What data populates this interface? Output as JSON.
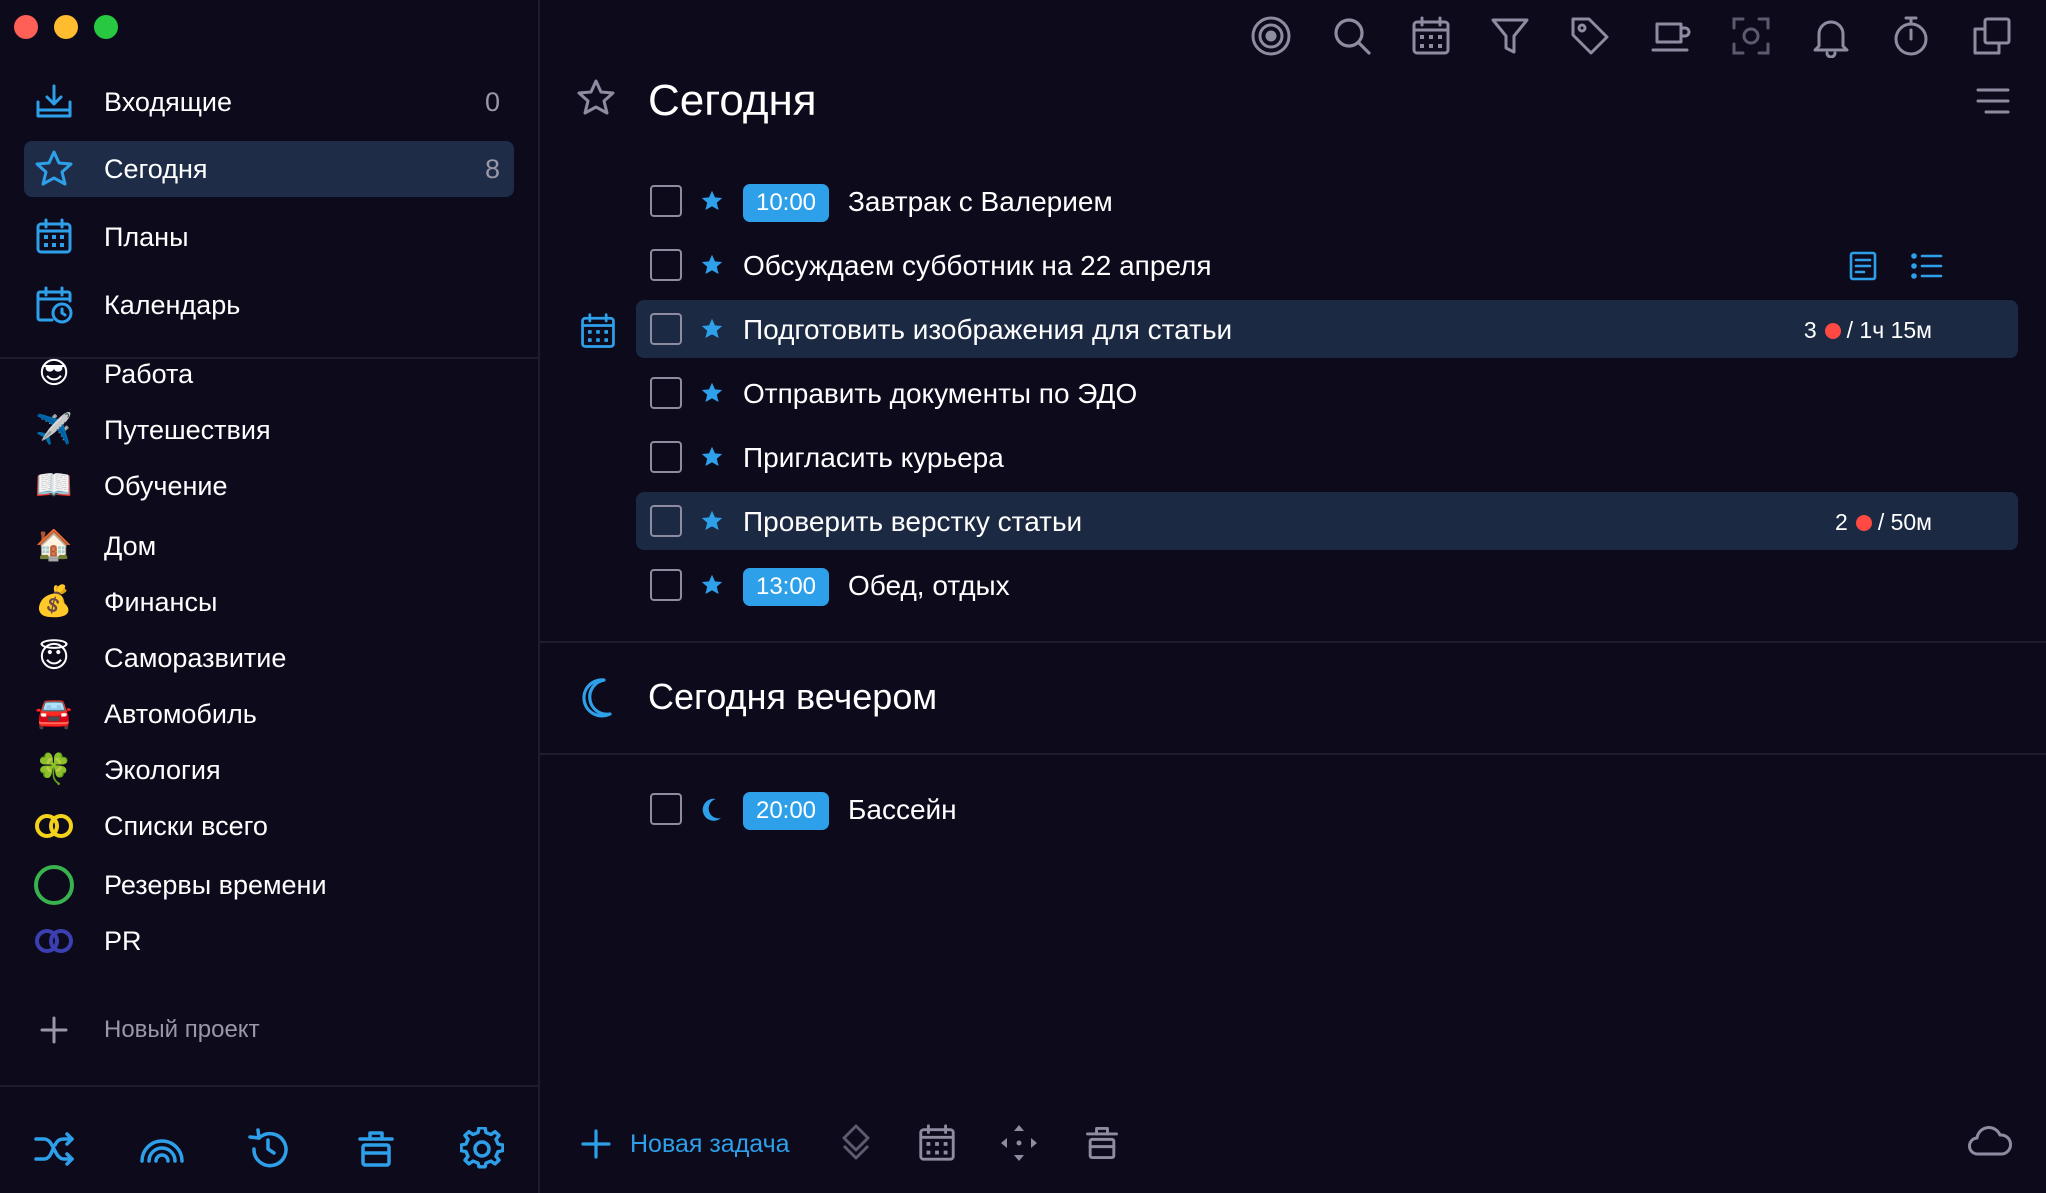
{
  "colors": {
    "background": "#0d0a1c",
    "active_row": "#1e2c48",
    "accent_blue": "#2ea0ea",
    "divider": "#1f1c30",
    "muted_text": "#9a98a8",
    "dot_red": "#ff4a43"
  },
  "window_controls": [
    "close",
    "minimize",
    "zoom"
  ],
  "sidebar": {
    "nav": [
      {
        "label": "Входящие",
        "count": "0",
        "icon": "inbox-icon"
      },
      {
        "label": "Сегодня",
        "count": "8",
        "icon": "star-icon",
        "active": true
      },
      {
        "label": "Планы",
        "count": "",
        "icon": "calendar-grid-icon"
      },
      {
        "label": "Календарь",
        "count": "",
        "icon": "calendar-clock-icon"
      }
    ],
    "projects": [
      {
        "label": "Работа",
        "icon": "😎"
      },
      {
        "label": "Путешествия",
        "icon": "✈️"
      },
      {
        "label": "Обучение",
        "icon": "📖"
      },
      {
        "label": "Дом",
        "icon": "🏠"
      },
      {
        "label": "Финансы",
        "icon": "💰"
      },
      {
        "label": "Саморазвитие",
        "icon": "😇"
      },
      {
        "label": "Автомобиль",
        "icon": "🚘"
      },
      {
        "label": "Экология",
        "icon": "🍀"
      },
      {
        "label": "Списки всего",
        "icon": "yellow-double-ring-icon"
      },
      {
        "label": "Резервы времени",
        "icon": "green-ring-icon"
      },
      {
        "label": "PR",
        "icon": "blue-double-ring-icon"
      }
    ],
    "new_project_label": "Новый проект",
    "bottom_icons": [
      "shuffle-icon",
      "rainbow-icon",
      "history-icon",
      "trash-icon",
      "settings-icon"
    ]
  },
  "toolbar": {
    "icons": [
      "focus-icon",
      "search-icon",
      "calendar-icon",
      "filter-icon",
      "tag-icon",
      "coffee-icon",
      "screenshot-icon",
      "bell-icon",
      "stopwatch-icon",
      "copy-icon"
    ]
  },
  "today": {
    "title": "Сегодня",
    "tasks": [
      {
        "time": "10:00",
        "title": "Завтрак с Валерием"
      },
      {
        "time": "",
        "title": "Обсуждаем субботник на 22 апреля"
      },
      {
        "time": "",
        "title": "Подготовить изображения для статьи",
        "meta_count": "3",
        "meta_duration": "/ 1ч 15м"
      },
      {
        "time": "",
        "title": "Отправить документы по ЭДО"
      },
      {
        "time": "",
        "title": "Пригласить курьера"
      },
      {
        "time": "",
        "title": "Проверить верстку статьи",
        "meta_count": "2",
        "meta_duration": "/ 50м"
      },
      {
        "time": "13:00",
        "title": "Обед, отдых"
      }
    ]
  },
  "evening": {
    "title": "Сегодня вечером",
    "tasks": [
      {
        "time": "20:00",
        "title": "Бассейн"
      }
    ]
  },
  "bottom_bar": {
    "new_task_label": "Новая задача",
    "icons": [
      "move-icon",
      "calendar-icon",
      "arrows-icon",
      "trash-icon",
      "cloud-icon"
    ]
  }
}
